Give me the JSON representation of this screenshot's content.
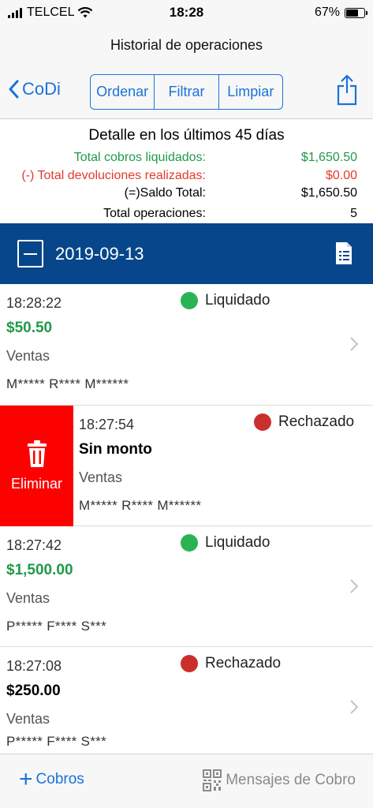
{
  "status_bar": {
    "carrier": "TELCEL",
    "time": "18:28",
    "battery": "67%",
    "battery_level": 0.67
  },
  "nav": {
    "title": "Historial de operaciones",
    "back_label": "CoDi",
    "segments": [
      "Ordenar",
      "Filtrar",
      "Limpiar"
    ]
  },
  "summary": {
    "heading": "Detalle en los últimos 45 días",
    "rows": [
      {
        "label": "Total cobros liquidados:",
        "value": "$1,650.50"
      },
      {
        "label": "(-) Total devoluciones realizadas:",
        "value": "$0.00"
      },
      {
        "label": "(=)Saldo Total:",
        "value": "$1,650.50"
      },
      {
        "label": "Total operaciones:",
        "value": "5"
      }
    ]
  },
  "date_group": {
    "date": "2019-09-13"
  },
  "operations": [
    {
      "time": "18:28:22",
      "status": "Liquidado",
      "amount": "$50.50",
      "category": "Ventas",
      "name": "M***** R**** M******",
      "status_color": "#2bb353"
    },
    {
      "time": "18:27:54",
      "status": "Rechazado",
      "amount": "Sin monto",
      "category": "Ventas",
      "name": "M***** R**** M******",
      "status_color": "#c9302c",
      "swipe_action": "Eliminar"
    },
    {
      "time": "18:27:42",
      "status": "Liquidado",
      "amount": "$1,500.00",
      "category": "Ventas",
      "name": "P***** F**** S***",
      "status_color": "#2bb353"
    },
    {
      "time": "18:27:08",
      "status": "Rechazado",
      "amount": "$250.00",
      "category": "Ventas",
      "name": "P***** F**** S***",
      "status_color": "#c9302c"
    }
  ],
  "tab_bar": {
    "left_label": "Cobros",
    "right_label": "Mensajes de Cobro"
  },
  "colors": {
    "accent": "#1a73d9",
    "header_blue": "#07468a",
    "green": "#1f9a4a",
    "red": "#e23b2b",
    "delete_red": "#fd0000"
  }
}
